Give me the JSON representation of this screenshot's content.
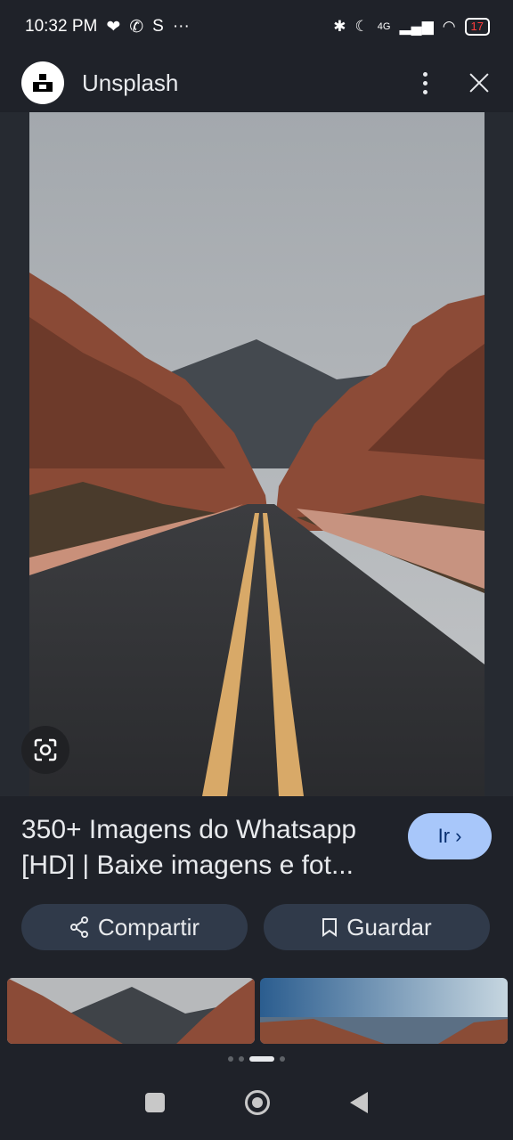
{
  "status_bar": {
    "time": "10:32 PM",
    "app_s": "S",
    "more": "···",
    "network": "4G",
    "battery": "17"
  },
  "header": {
    "title": "Unsplash"
  },
  "result": {
    "title_line1": "350+ Imagens do Whatsapp",
    "title_line2": "[HD] | Baixe imagens e fot...",
    "go_label": "Ir"
  },
  "actions": {
    "share_label": "Compartir",
    "save_label": "Guardar"
  },
  "colors": {
    "background": "#1f2229",
    "accent": "#a8c7fa",
    "pill": "#303a4a"
  }
}
